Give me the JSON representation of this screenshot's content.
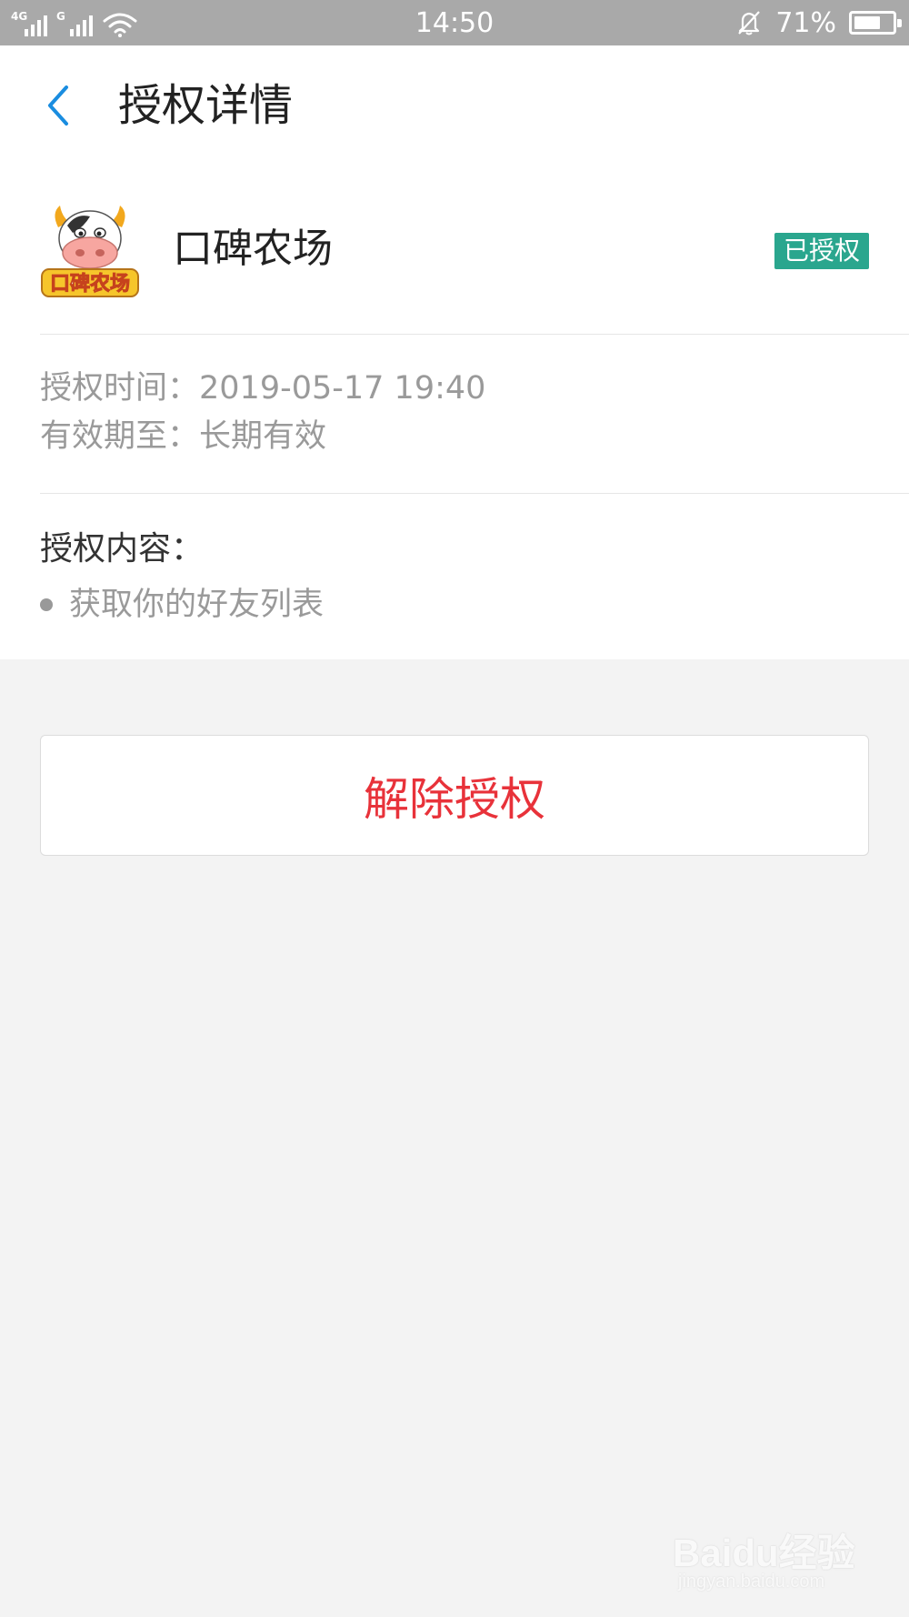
{
  "status_bar": {
    "network_1": "4G",
    "network_2": "G",
    "time": "14:50",
    "battery_percent_text": "71%",
    "battery_level": 0.71
  },
  "header": {
    "title": "授权详情",
    "back_icon": "chevron-left-icon",
    "accent_color": "#1a8de0"
  },
  "app": {
    "name": "口碑农场",
    "icon_text": "口碑农场",
    "status_badge": "已授权",
    "badge_color": "#2aa68e"
  },
  "details": {
    "auth_time_label": "授权时间：",
    "auth_time_value": "2019-05-17 19:40",
    "valid_until_label": "有效期至：",
    "valid_until_value": "长期有效"
  },
  "permissions": {
    "title": "授权内容：",
    "items": [
      "获取你的好友列表"
    ]
  },
  "actions": {
    "revoke_label": "解除授权",
    "revoke_color": "#e8323a"
  },
  "watermark": {
    "brand": "Baidu经验",
    "url": "jingyan.baidu.com"
  }
}
